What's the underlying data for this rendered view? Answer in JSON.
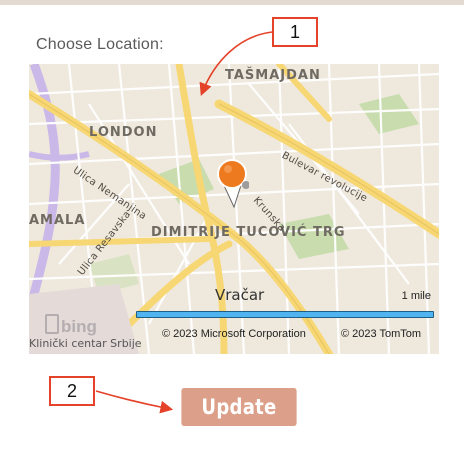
{
  "form": {
    "choose_location_label": "Choose Location:",
    "update_button_label": "Update"
  },
  "map": {
    "districts": {
      "tasmajdan": "TAŠMAJDAN",
      "london": "LONDON",
      "dimitrije": "DIMITRIJE TUCOVIĆ TRG",
      "amala": "AMALA",
      "vracar": "Vračar"
    },
    "streets": {
      "nemanjina": "Ulica Nemanjina",
      "resavska": "Ulica Resavska",
      "bulevar": "Bulevar revolucije",
      "krunska": "Krunska"
    },
    "poi": {
      "klinicki": "Klinički centar Srbije"
    },
    "scale_label": "1 mile",
    "copyright_microsoft": "© 2023 Microsoft Corporation",
    "copyright_tomtom": "© 2023 TomTom",
    "provider_logo_text": "bing",
    "colors": {
      "road_major": "#f7d774",
      "road_minor": "#ffffff",
      "park": "#c8dcae",
      "base": "#efe9dd",
      "pin": "#ee7a1f",
      "scale_bar": "#4fb4f0"
    }
  },
  "annotations": {
    "callout_1": "1",
    "callout_2": "2",
    "arrow_color": "#e44229"
  },
  "theme": {
    "button_color": "#dca08a"
  }
}
